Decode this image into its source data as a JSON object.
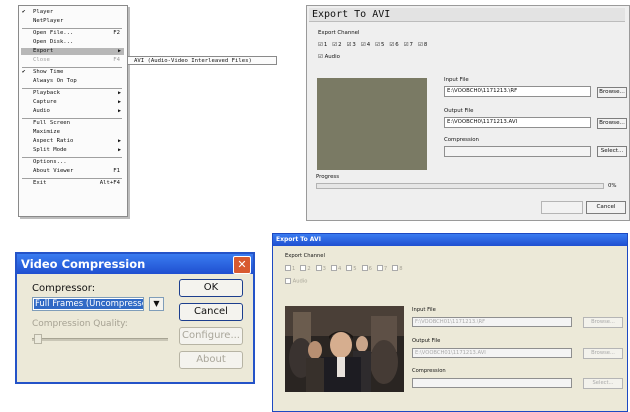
{
  "menu": {
    "items": [
      {
        "check": "✔",
        "label": "Player",
        "shortcut": "",
        "arrow": "",
        "state": ""
      },
      {
        "check": "",
        "label": "NetPlayer",
        "shortcut": "",
        "arrow": "",
        "state": ""
      },
      {
        "check": "",
        "label": "Open File...",
        "shortcut": "F2",
        "arrow": "",
        "state": ""
      },
      {
        "check": "",
        "label": "Open Disk...",
        "shortcut": "",
        "arrow": "",
        "state": ""
      },
      {
        "check": "",
        "label": "Export",
        "shortcut": "",
        "arrow": "▶",
        "state": "sel"
      },
      {
        "check": "",
        "label": "Close",
        "shortcut": "F4",
        "arrow": "",
        "state": "dis"
      },
      {
        "check": "✔",
        "label": "Show Time",
        "shortcut": "",
        "arrow": "",
        "state": ""
      },
      {
        "check": "",
        "label": "Always On Top",
        "shortcut": "",
        "arrow": "",
        "state": ""
      },
      {
        "check": "",
        "label": "Playback",
        "shortcut": "",
        "arrow": "▶",
        "state": ""
      },
      {
        "check": "",
        "label": "Capture",
        "shortcut": "",
        "arrow": "▶",
        "state": ""
      },
      {
        "check": "",
        "label": "Audio",
        "shortcut": "",
        "arrow": "▶",
        "state": ""
      },
      {
        "check": "",
        "label": "Full Screen",
        "shortcut": "",
        "arrow": "",
        "state": ""
      },
      {
        "check": "",
        "label": "Maximize",
        "shortcut": "",
        "arrow": "",
        "state": ""
      },
      {
        "check": "",
        "label": "Aspect Ratio",
        "shortcut": "",
        "arrow": "▶",
        "state": ""
      },
      {
        "check": "",
        "label": "Split Mode",
        "shortcut": "",
        "arrow": "▶",
        "state": ""
      },
      {
        "check": "",
        "label": "Options...",
        "shortcut": "",
        "arrow": "",
        "state": ""
      },
      {
        "check": "",
        "label": "About Viewer",
        "shortcut": "F1",
        "arrow": "",
        "state": ""
      },
      {
        "check": "",
        "label": "Exit",
        "shortcut": "Alt+F4",
        "arrow": "",
        "state": ""
      }
    ],
    "submenu_label": "AVI (Audio-Video Interleaved Files)"
  },
  "export_dialog": {
    "title": "Export To AVI",
    "export_channel_label": "Export Channel",
    "channels": [
      "1",
      "2",
      "3",
      "4",
      "5",
      "6",
      "7",
      "8"
    ],
    "audio_label": "Audio",
    "input_file_label": "Input File",
    "input_file_value": "E:\\VOOBCH0\\1171213.\\RF",
    "output_file_label": "Output File",
    "output_file_value": "E:\\VOOBCH0\\1171213.AVI",
    "compression_label": "Compression",
    "compression_value": "",
    "progress_label": "Progress",
    "progress_pct": "0%",
    "browse_label": "Browse...",
    "select_label": "Select...",
    "ok_label": "OK",
    "cancel_label": "Cancel"
  },
  "compression_dialog": {
    "title": "Video Compression",
    "close_glyph": "✕",
    "compressor_label": "Compressor:",
    "compressor_value": "Full Frames (Uncompressed)",
    "quality_label": "Compression Quality:",
    "ok_label": "OK",
    "cancel_label": "Cancel",
    "configure_label": "Configure...",
    "about_label": "About"
  },
  "export_dialog_xp": {
    "title": "Export To AVI",
    "export_channel_label": "Export Channel",
    "channels": [
      "1",
      "2",
      "3",
      "4",
      "5",
      "6",
      "7",
      "8"
    ],
    "audio_label": "Audio",
    "input_file_label": "Input File",
    "input_file_value": "F:\\VOOBCH01\\1171213.\\RF",
    "output_file_label": "Output File",
    "output_file_value": "E:\\VOOBCH01\\1171213.AVI",
    "compression_label": "Compression",
    "compression_value": "",
    "browse_label": "Browse...",
    "select_label": "Select..."
  },
  "colors": {
    "xp_title_blue": "#1f4fd0",
    "xp_face": "#ece9d8",
    "classic_face": "#efefef",
    "close_red": "#d85a30",
    "preview_olive": "#7a7a64"
  }
}
